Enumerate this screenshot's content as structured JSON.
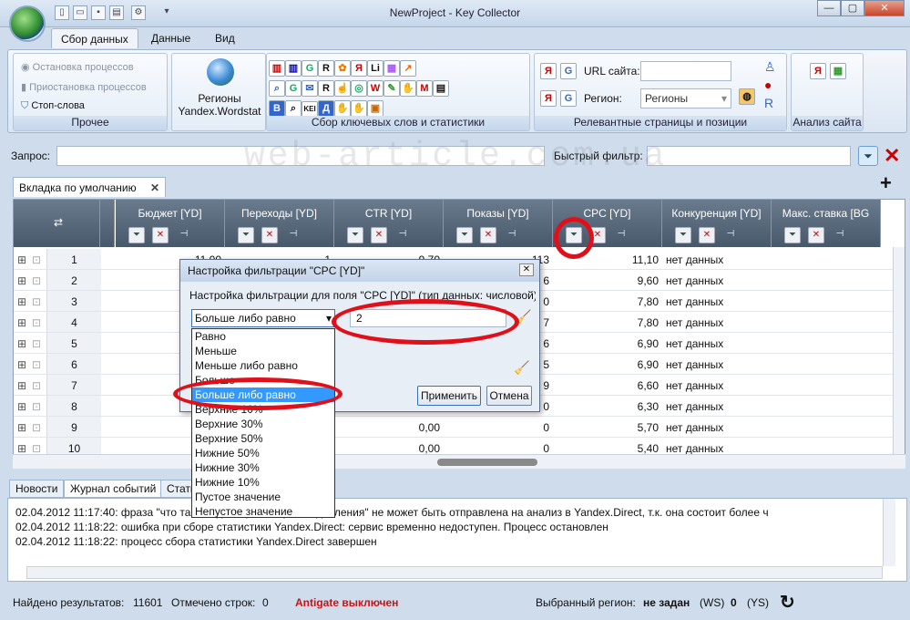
{
  "window": {
    "title": "NewProject - Key Collector",
    "min": "—",
    "max": "▢",
    "close": "✕"
  },
  "ribbon_tabs": [
    "Сбор данных",
    "Данные",
    "Вид"
  ],
  "ribbon": {
    "group_misc": {
      "label": "Прочее",
      "stop": "Остановка процессов",
      "pause": "Приостановка процессов",
      "stopwords": "Стоп-слова"
    },
    "group_regions": {
      "line1": "Регионы",
      "line2": "Yandex.Wordstat"
    },
    "group_collect": {
      "label": "Сбор ключевых слов и статистики"
    },
    "group_relevant": {
      "label": "Релевантные страницы и позиции",
      "url_label": "URL сайта:",
      "region_label": "Регион:",
      "region_value": "Регионы"
    },
    "group_analysis": {
      "label": "Анализ сайта"
    }
  },
  "query": {
    "label": "Запрос:",
    "filter_label": "Быстрый фильтр:"
  },
  "doc_tab": "Вкладка по умолчанию",
  "grid": {
    "columns": [
      "Бюджет [YD]",
      "Переходы [YD]",
      "CTR [YD]",
      "Показы [YD]",
      "CPC [YD]",
      "Конкуренция [YD]",
      "Макс. ставка [BG"
    ],
    "rows": [
      {
        "n": "1",
        "budget": "11,00",
        "trans": "1",
        "ctr": "9,70",
        "shows": "113",
        "cpc": "11,10",
        "comp": "нет данных"
      },
      {
        "n": "2",
        "budget": "",
        "trans": "",
        "ctr": "",
        "shows": "6",
        "cpc": "9,60",
        "comp": "нет данных"
      },
      {
        "n": "3",
        "budget": "",
        "trans": "",
        "ctr": "",
        "shows": "0",
        "cpc": "7,80",
        "comp": "нет данных"
      },
      {
        "n": "4",
        "budget": "",
        "trans": "",
        "ctr": "",
        "shows": "7",
        "cpc": "7,80",
        "comp": "нет данных"
      },
      {
        "n": "5",
        "budget": "",
        "trans": "",
        "ctr": "",
        "shows": "6",
        "cpc": "6,90",
        "comp": "нет данных"
      },
      {
        "n": "6",
        "budget": "",
        "trans": "",
        "ctr": "",
        "shows": "5",
        "cpc": "6,90",
        "comp": "нет данных"
      },
      {
        "n": "7",
        "budget": "",
        "trans": "",
        "ctr": "",
        "shows": "9",
        "cpc": "6,60",
        "comp": "нет данных"
      },
      {
        "n": "8",
        "budget": "",
        "trans": "",
        "ctr": "",
        "shows": "0",
        "cpc": "6,30",
        "comp": "нет данных"
      },
      {
        "n": "9",
        "budget": "",
        "trans": "",
        "ctr": "0,00",
        "shows": "0",
        "cpc": "5,70",
        "comp": "нет данных"
      },
      {
        "n": "10",
        "budget": "",
        "trans": "",
        "ctr": "0,00",
        "shows": "0",
        "cpc": "5,40",
        "comp": "нет данных"
      }
    ]
  },
  "dialog": {
    "title": "Настройка фильтрации \"CPC [YD]\"",
    "desc": "Настройка фильтрации для поля \"CPC [YD]\" (тип данных: числовой)",
    "selected": "Больше либо равно",
    "value": "2",
    "apply": "Применить",
    "cancel": "Отмена",
    "options": [
      "Равно",
      "Меньше",
      "Меньше либо равно",
      "Больше",
      "Больше либо равно",
      "Верхние 10%",
      "Верхние 30%",
      "Верхние 50%",
      "Нижние 50%",
      "Нижние 30%",
      "Нижние 10%",
      "Пустое значение",
      "Непустое значение"
    ]
  },
  "log_tabs": [
    "Новости",
    "Журнал событий",
    "Стати"
  ],
  "log": [
    "02.04.2012 11:17:40: фраза \"что таков                              единицы измерения давления\" не может быть отправлена на анализ в Yandex.Direct, т.к. она состоит более ч",
    "02.04.2012 11:18:22: ошибка при сборе статистики Yandex.Direct: сервис временно недоступен. Процесс остановлен",
    "02.04.2012 11:18:22: процесс сбора статистики Yandex.Direct завершен"
  ],
  "status": {
    "found_label": "Найдено результатов:",
    "found": "11601",
    "marked_label": "Отмечено строк:",
    "marked": "0",
    "antigate": "Antigate выключен",
    "region_label": "Выбранный регион:",
    "region": "не задан",
    "ws_label": "(WS)",
    "ws": "0",
    "ys_label": "(YS)",
    "antigate_color": "#d01010"
  },
  "watermark": "web-article.com.ua"
}
